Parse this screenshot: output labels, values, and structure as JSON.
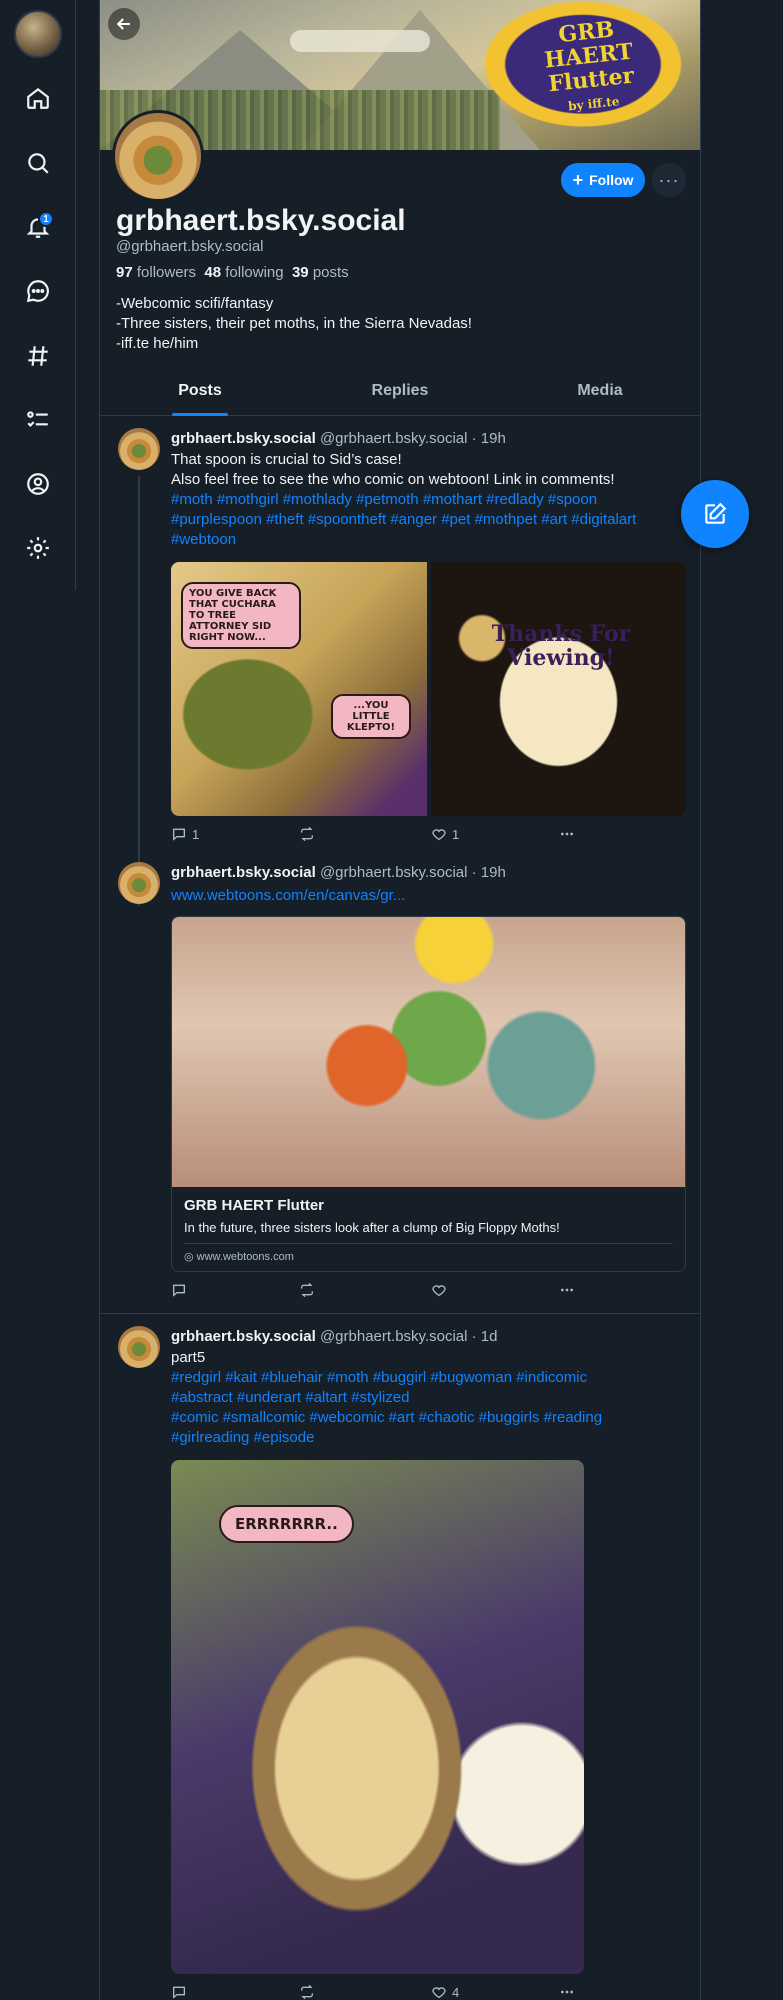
{
  "nav": {
    "notifications_badge": "1",
    "items": [
      "home-icon",
      "search-icon",
      "bell-icon",
      "chat-icon",
      "hashtag-icon",
      "list-icon",
      "profile-icon",
      "gear-icon"
    ]
  },
  "banner": {
    "logo_text": "GRB HAERT Flutter",
    "logo_sub": "by iff.te"
  },
  "profile": {
    "display_name": "grbhaert.bsky.social",
    "handle": "@grbhaert.bsky.social",
    "followers_count": "97",
    "followers_label": "followers",
    "following_count": "48",
    "following_label": "following",
    "posts_count": "39",
    "posts_label": "posts",
    "bio_line1": "-Webcomic  scifi/fantasy",
    "bio_line2": "-Three sisters, their pet moths, in the Sierra Nevadas!",
    "bio_line3": "-iff.te he/him",
    "follow_label": "Follow",
    "more_label": "···"
  },
  "tabs": [
    {
      "label": "Posts",
      "active": true
    },
    {
      "label": "Replies",
      "active": false
    },
    {
      "label": "Media",
      "active": false
    }
  ],
  "posts": [
    {
      "author": "grbhaert.bsky.social",
      "handle_time": "@grbhaert.bsky.social · 19h",
      "line1": "That spoon is crucial to Sid’s case!",
      "line2": "Also feel free to see the who comic on webtoon! Link in comments!",
      "tags1": "#moth #mothgirl #mothlady #petmoth #mothart #redlady #spoon",
      "tags2": "#purplespoon #theft #spoontheft #anger #pet #mothpet #art #digitalart",
      "tags3": "#webtoon",
      "bubble1": "YOU GIVE BACK THAT CUCHARA TO TREE ATTORNEY SID RIGHT NOW...",
      "bubble2": "...YOU LITTLE KLEPTO!",
      "thanks_text": "Thanks For Viewing!",
      "replies": "1",
      "reposts": "",
      "likes": "1"
    },
    {
      "author": "grbhaert.bsky.social",
      "handle_time": "@grbhaert.bsky.social · 19h",
      "link": "www.webtoons.com/en/canvas/gr...",
      "card_title": "GRB HAERT Flutter",
      "card_desc": "In the future, three sisters look after a clump of Big Floppy Moths!",
      "card_domain": "www.webtoons.com",
      "replies": "",
      "reposts": "",
      "likes": ""
    },
    {
      "author": "grbhaert.bsky.social",
      "handle_time": "@grbhaert.bsky.social · 1d",
      "line1": "part5",
      "tags1": "#redgirl #kait #bluehair #moth #buggirl #bugwoman  #indicomic",
      "tags2": "#abstract #underart #altart #stylized",
      "tags3": "#comic #smallcomic #webcomic #art #chaotic  #buggirls #reading",
      "tags4": "#girlreading #episode",
      "bubble": "ERRRRRRR..",
      "replies": "",
      "reposts": "",
      "likes": "4"
    }
  ],
  "colors": {
    "background": "#161e27",
    "accent": "#1083fe",
    "border": "#2e3b49",
    "muted_text": "#aebbc9"
  }
}
